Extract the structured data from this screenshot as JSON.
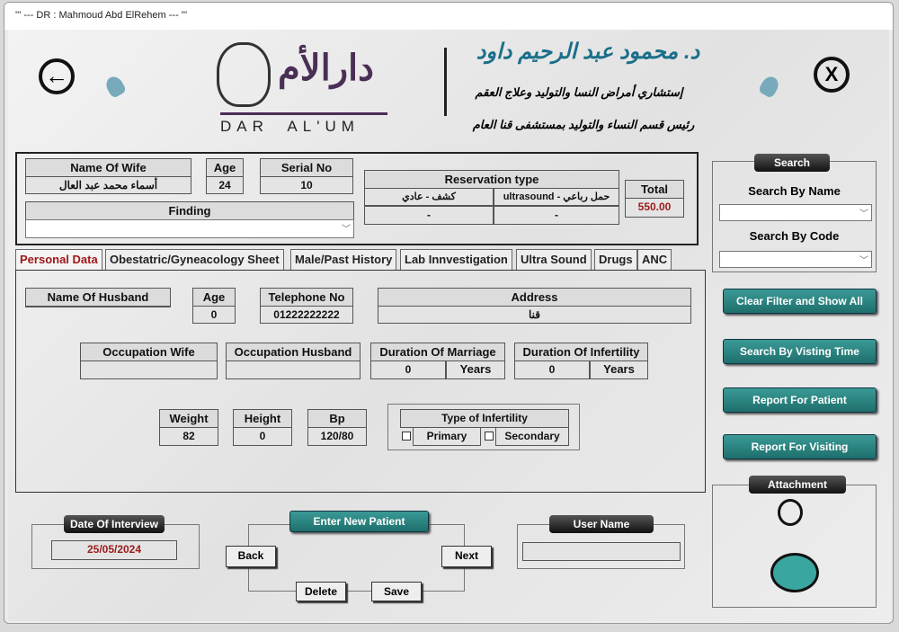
{
  "window": {
    "title": "'''  ---   DR : Mahmoud Abd ElRehem  ---   '''"
  },
  "header": {
    "logo_ar": "دارالأم",
    "logo_en": "DAR  AL'UM",
    "doctor_name": "د. محمود عبد الرحيم داود",
    "line1": "إستشاري أمراض النسا والتوليد وعلاج العقم",
    "line2": "رئيس قسم النساء والتوليد بمستشفى قنا العام"
  },
  "patient": {
    "name_label": "Name Of Wife",
    "name": "أسماء محمد عبد العال",
    "age_label": "Age",
    "age": "24",
    "serial_label": "Serial No",
    "serial": "10",
    "finding_label": "Finding",
    "finding": "",
    "reservation_label": "Reservation type",
    "res_col1": "كشف - عادي",
    "res_col2": "حمل رباعي - ultrasound",
    "res_val1": "-",
    "res_val2": "-",
    "total_label": "Total",
    "total": "550.00"
  },
  "tabs": [
    "Personal Data",
    "Obestatric/Gyneacology Sheet",
    "Male/Past History",
    "Lab Innvestigation",
    "Ultra Sound",
    "Drugs",
    "ANC"
  ],
  "personal": {
    "husband_label": "Name Of Husband",
    "husband": "",
    "hage_label": "Age",
    "hage": "0",
    "tel_label": "Telephone No",
    "tel": "01222222222",
    "address_label": "Address",
    "address": "قنا",
    "occ_wife_label": "Occupation Wife",
    "occ_wife": "",
    "occ_husband_label": "Occupation Husband",
    "occ_husband": "",
    "marriage_label": "Duration Of Marriage",
    "marriage": "0",
    "infert_label": "Duration Of Infertility",
    "infert": "0",
    "years": "Years",
    "weight_label": "Weight",
    "weight": "82",
    "height_label": "Height",
    "height": "0",
    "bp_label": "Bp",
    "bp": "120/80",
    "type_label": "Type of Infertility",
    "primary": "Primary",
    "secondary": "Secondary"
  },
  "search": {
    "title": "Search",
    "by_name": "Search By Name",
    "by_code": "Search By Code"
  },
  "actions": [
    "Clear Filter and Show All",
    "Search By Visting Time",
    "Report For Patient",
    "Report For Visiting"
  ],
  "attachment": "Attachment",
  "bottom": {
    "date_label": "Date Of Interview",
    "date": "25/05/2024",
    "enter_new": "Enter New Patient",
    "back": "Back",
    "next": "Next",
    "delete": "Delete",
    "save": "Save",
    "user_label": "User Name",
    "user": ""
  }
}
